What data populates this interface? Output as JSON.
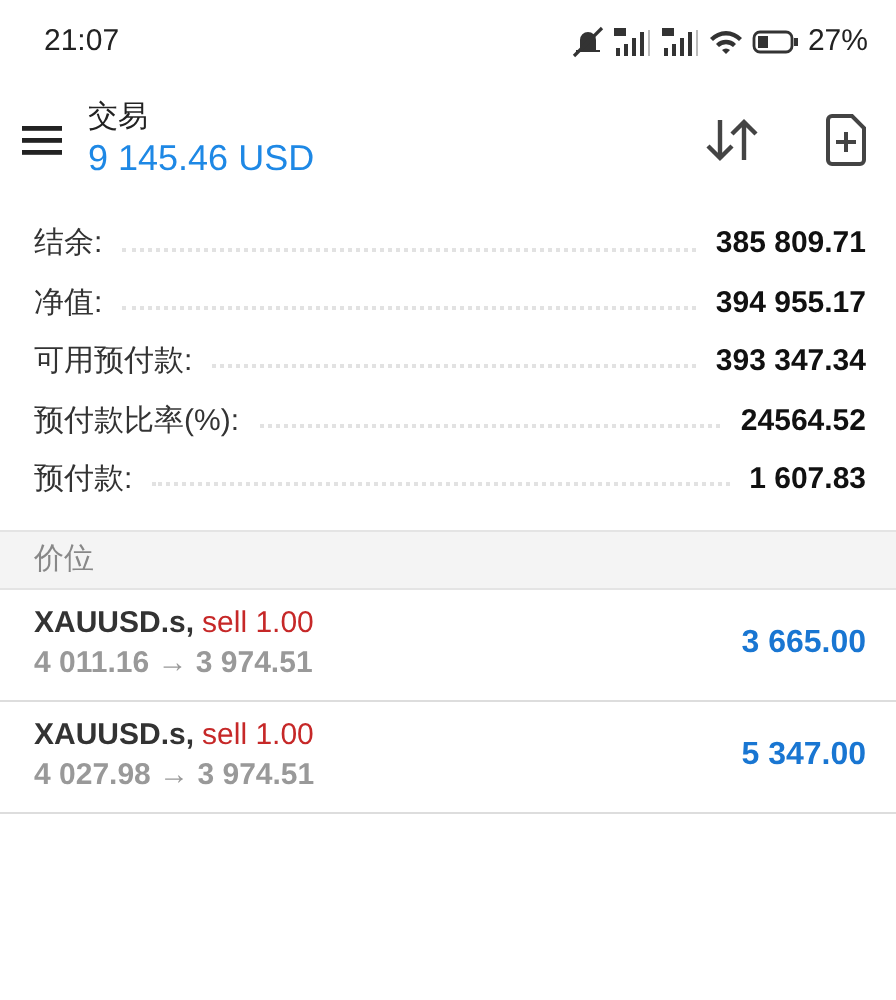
{
  "status_bar": {
    "time": "21:07",
    "battery_text": "27%"
  },
  "header": {
    "title": "交易",
    "balance": "9 145.46 USD"
  },
  "summary": [
    {
      "label": "结余:",
      "value": "385 809.71"
    },
    {
      "label": "净值:",
      "value": "394 955.17"
    },
    {
      "label": "可用预付款:",
      "value": "393 347.34"
    },
    {
      "label": "预付款比率(%):",
      "value": "24564.52"
    },
    {
      "label": "预付款:",
      "value": "1 607.83"
    }
  ],
  "positions_header": "价位",
  "positions": [
    {
      "symbol": "XAUUSD.s,",
      "action": "sell 1.00",
      "prices": "4 011.16 → 3 974.51",
      "profit": "3 665.00"
    },
    {
      "symbol": "XAUUSD.s,",
      "action": "sell 1.00",
      "prices": "4 027.98 → 3 974.51",
      "profit": "5 347.00"
    }
  ]
}
